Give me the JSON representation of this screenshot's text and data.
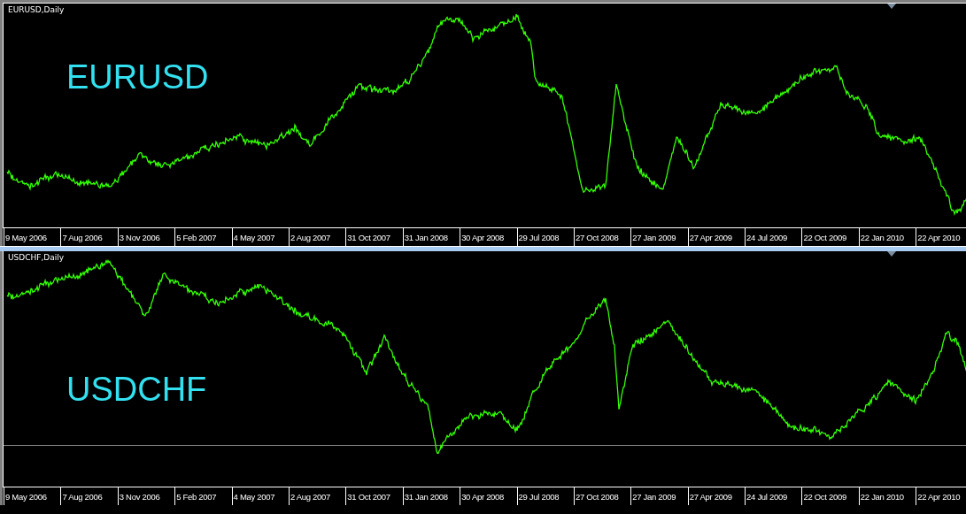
{
  "charts": [
    {
      "title": "EURUSD,Daily",
      "symbol": "EURUSD",
      "dates": [
        "9 May 2006",
        "7 Aug 2006",
        "3 Nov 2006",
        "5 Feb 2007",
        "4 May 2007",
        "2 Aug 2007",
        "31 Oct 2007",
        "31 Jan 2008",
        "30 Apr 2008",
        "29 Jul 2008",
        "27 Oct 2008",
        "27 Jan 2009",
        "27 Apr 2009",
        "24 Jul 2009",
        "22 Oct 2009",
        "22 Jan 2010",
        "22 Apr 2010"
      ]
    },
    {
      "title": "USDCHF,Daily",
      "symbol": "USDCHF",
      "dates": [
        "9 May 2006",
        "7 Aug 2006",
        "3 Nov 2006",
        "5 Feb 2007",
        "4 May 2007",
        "2 Aug 2007",
        "31 Oct 2007",
        "31 Jan 2008",
        "30 Apr 2008",
        "29 Jul 2008",
        "27 Oct 2008",
        "27 Jan 2009",
        "27 Apr 2009",
        "24 Jul 2009",
        "22 Oct 2009",
        "22 Jan 2010",
        "22 Apr 2010"
      ]
    }
  ]
}
